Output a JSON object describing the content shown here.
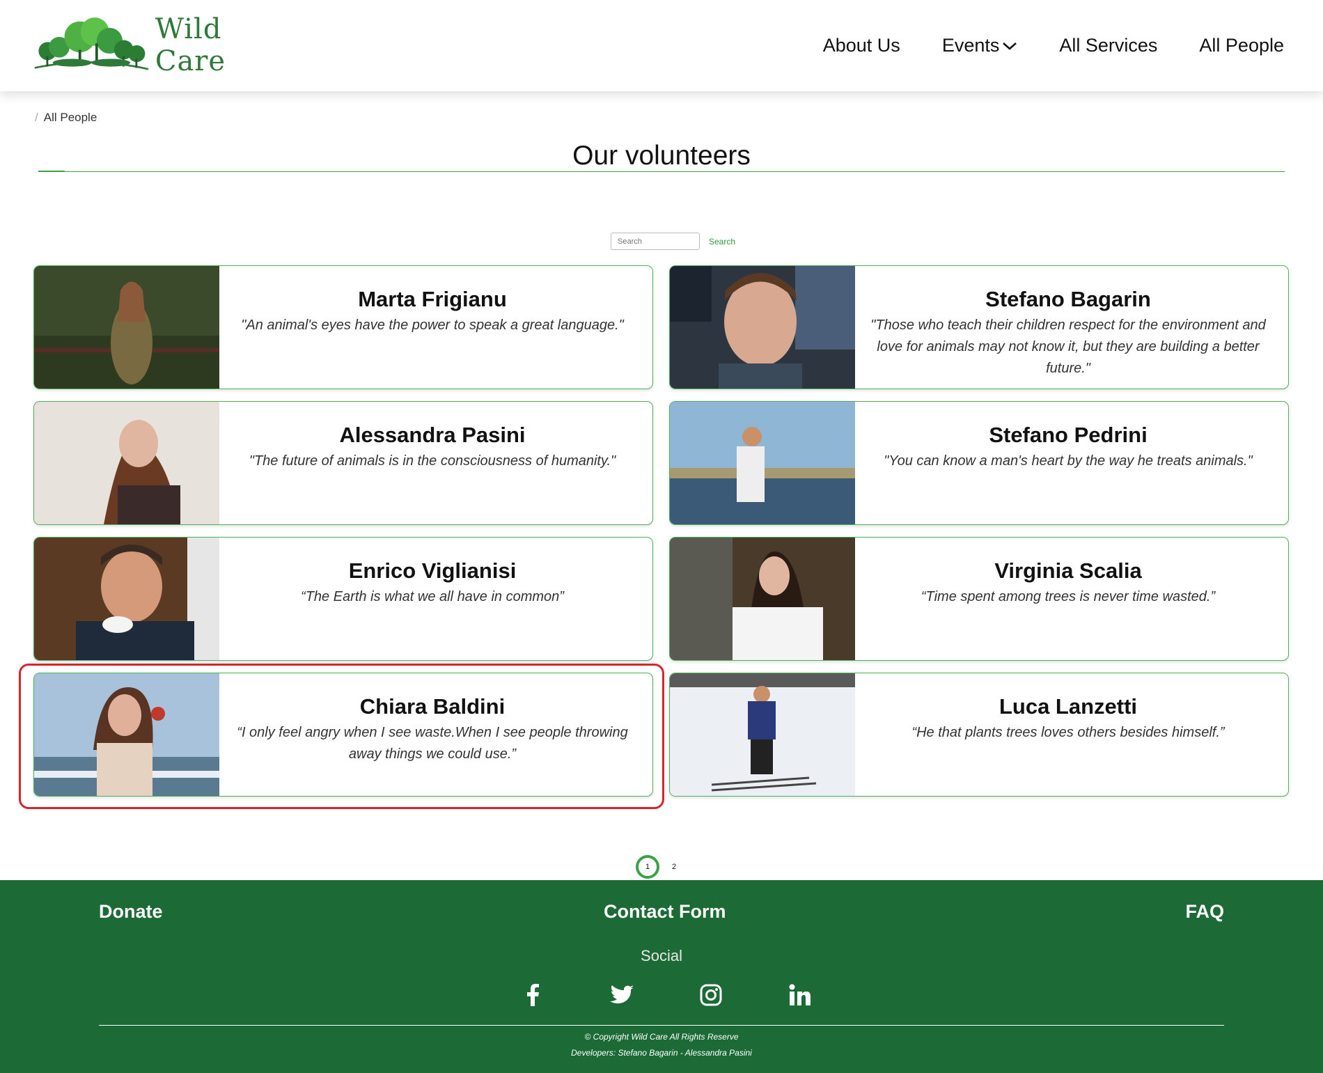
{
  "brand": {
    "name": "Wild Care"
  },
  "nav": {
    "items": [
      "About Us",
      "Events",
      "All Services",
      "All People"
    ]
  },
  "breadcrumb": {
    "current": "All People"
  },
  "page": {
    "title": "Our volunteers"
  },
  "search": {
    "placeholder": "Search",
    "button": "Search"
  },
  "volunteers": [
    {
      "name": "Marta Frigianu",
      "quote": "\"An animal's eyes have the power to speak a great language.\""
    },
    {
      "name": "Stefano Bagarin",
      "quote": "\"Those who teach their children respect for the environment and love for animals may not know it, but they are building a better future.\""
    },
    {
      "name": "Alessandra Pasini",
      "quote": "\"The future of animals is in the consciousness of humanity.\""
    },
    {
      "name": "Stefano Pedrini",
      "quote": "\"You can know a man's heart by the way he treats animals.\""
    },
    {
      "name": "Enrico Viglianisi",
      "quote": "“The Earth is what we all have in common”"
    },
    {
      "name": "Virginia Scalia",
      "quote": "“Time spent among trees is never time wasted.”"
    },
    {
      "name": "Chiara Baldini",
      "quote": "“I only feel angry when I see waste.When I see people throwing away things we could use.”"
    },
    {
      "name": "Luca Lanzetti",
      "quote": "“He that plants trees loves others besides himself.”"
    }
  ],
  "pagination": {
    "pages": [
      "1",
      "2"
    ],
    "current": "1"
  },
  "footer": {
    "donate": "Donate",
    "contact": "Contact Form",
    "faq": "FAQ",
    "social_label": "Social",
    "social_icons": [
      "facebook-icon",
      "twitter-icon",
      "instagram-icon",
      "linkedin-icon"
    ],
    "copyright": "© Copyright Wild Care All Rights Reserve",
    "developers": "Developers: Stefano Bagarin - Alessandra Pasini"
  },
  "colors": {
    "brand_green": "#2f7a38",
    "footer_green": "#1c6a36",
    "card_border": "#4cb25a",
    "highlight": "#d9232d"
  }
}
